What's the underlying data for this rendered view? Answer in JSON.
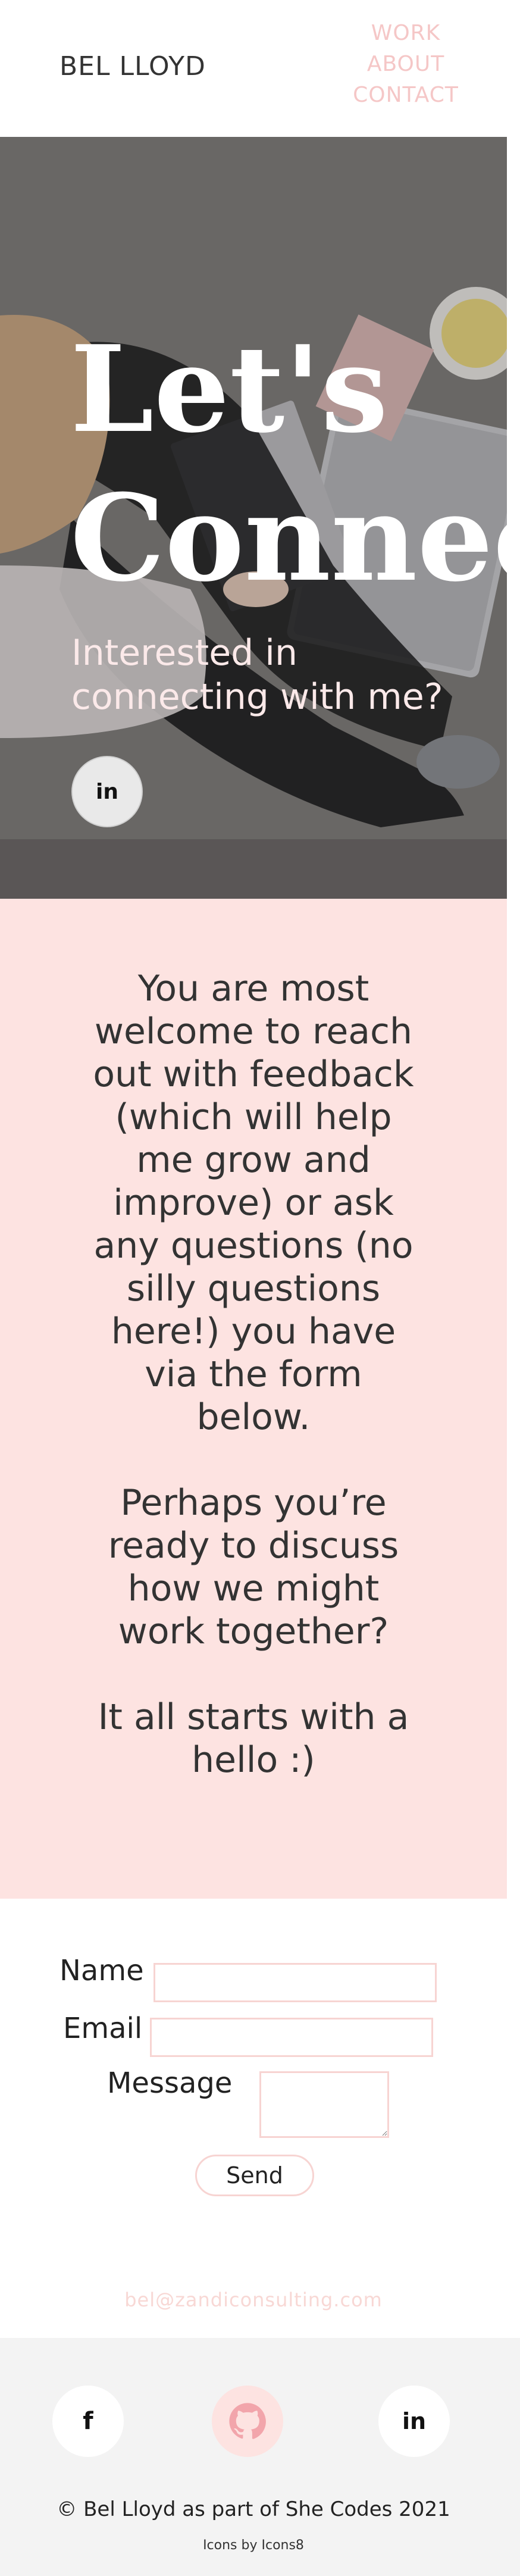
{
  "header": {
    "brand": "BEL LLOYD",
    "nav": [
      {
        "label": "WORK"
      },
      {
        "label": "ABOUT"
      },
      {
        "label": "CONTACT"
      }
    ]
  },
  "hero": {
    "title_line1": "Let's",
    "title_line2": "Connect",
    "subtitle": "Interested in connecting with me?",
    "linkedin_label": "in"
  },
  "intro": {
    "paragraph1": "You are most welcome to reach out with feedback (which will help me grow and improve) or ask any questions (no silly questions here!) you have via the form below.",
    "paragraph2": "Perhaps you’re ready to discuss how we might work together?",
    "paragraph3": "It all starts with a hello :)"
  },
  "form": {
    "name_label": "Name",
    "email_label": "Email",
    "message_label": "Message",
    "name_value": "",
    "email_value": "",
    "message_value": "",
    "send_label": "Send"
  },
  "contact_email": "bel@zandiconsulting.com",
  "footer": {
    "facebook_label": "f",
    "linkedin_label": "in",
    "copyright": "© Bel Lloyd as part of She Codes 2021",
    "icons_credit": "Icons by Icons8"
  },
  "colors": {
    "accent_pink": "#f5c7c7",
    "section_pink": "#fde3e1",
    "footer_bg": "#f3f3f3"
  }
}
